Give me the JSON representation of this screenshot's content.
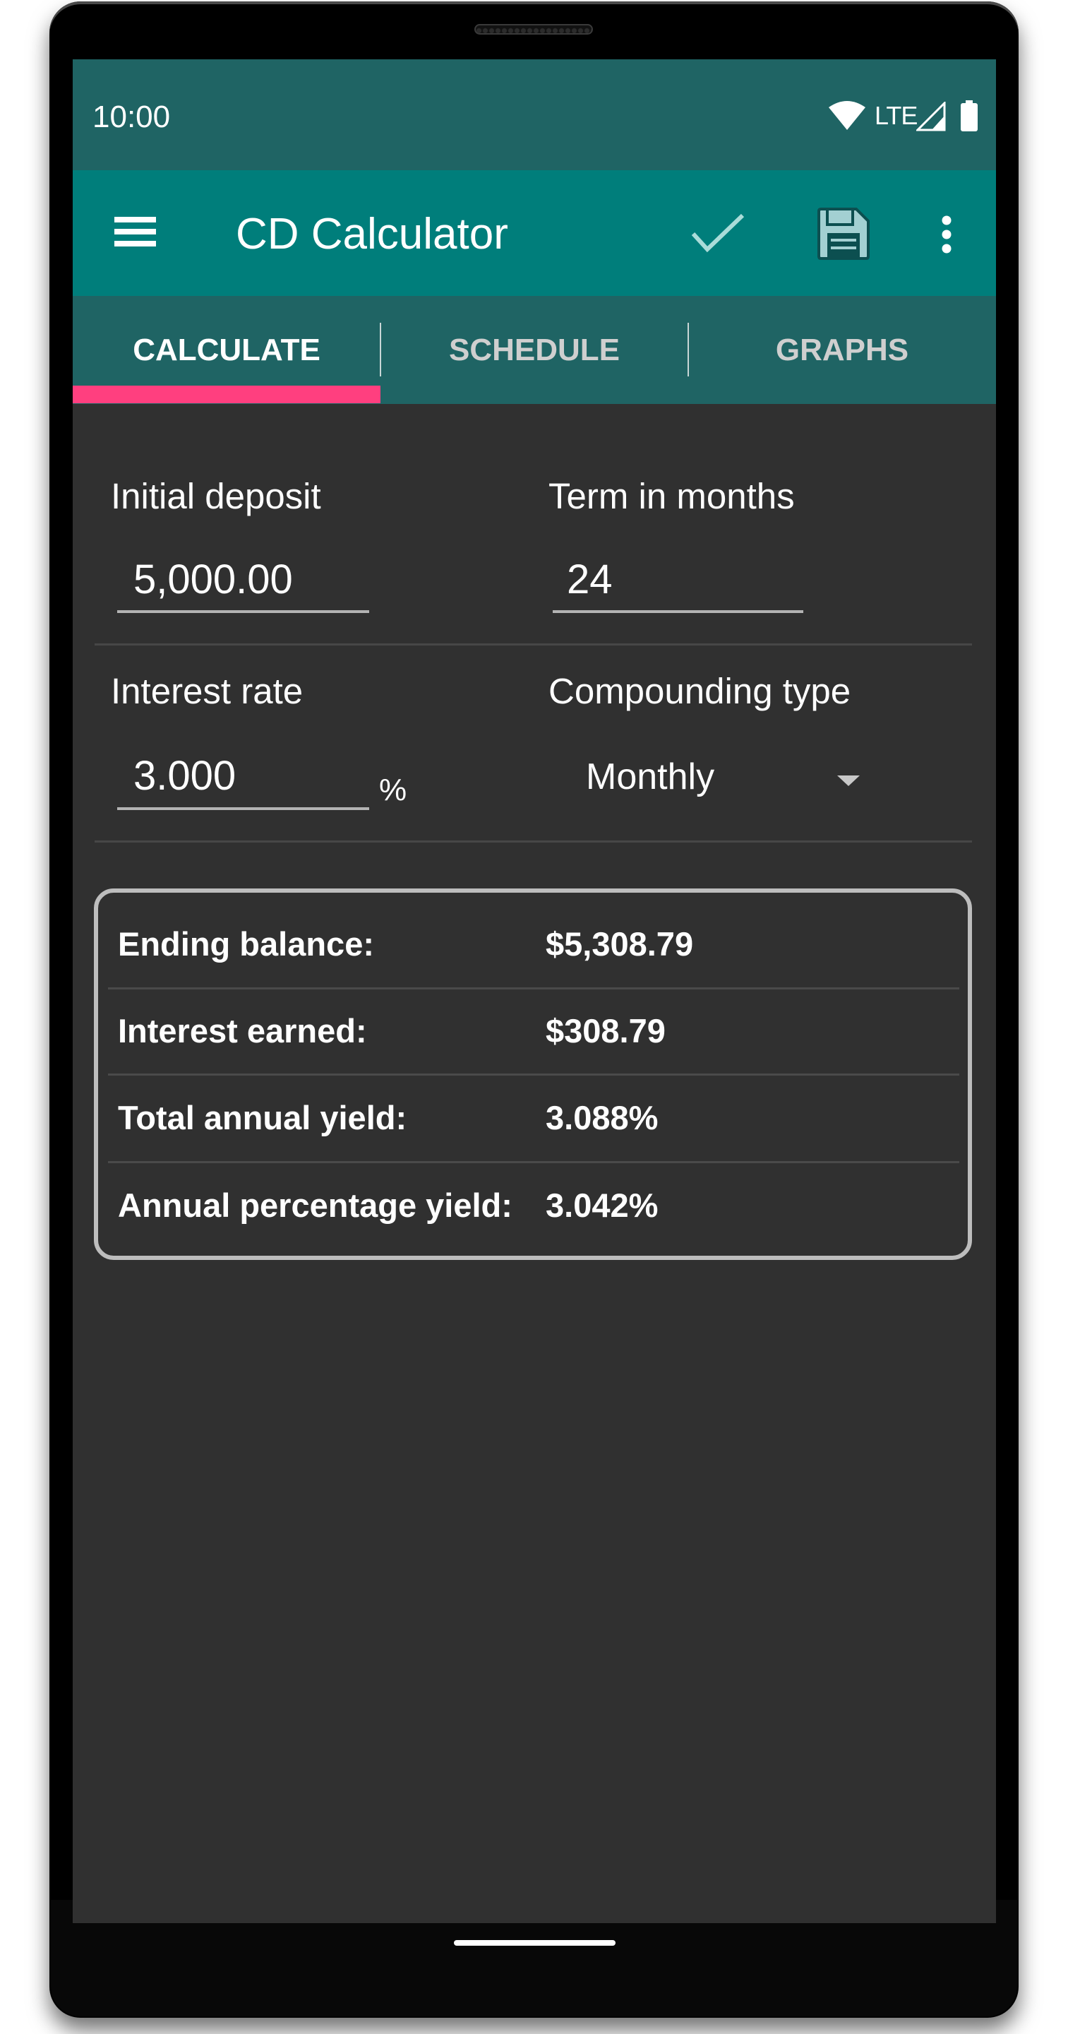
{
  "status_bar": {
    "time": "10:00",
    "network_label": "LTE",
    "icons": [
      "wifi-icon",
      "cell-signal-icon",
      "battery-icon"
    ]
  },
  "toolbar": {
    "menu_icon": "hamburger-menu-icon",
    "title": "CD Calculator",
    "actions": [
      "checkmark-icon",
      "save-floppy-icon",
      "more-vert-icon"
    ]
  },
  "tabs": [
    {
      "label": "CALCULATE",
      "active": true
    },
    {
      "label": "SCHEDULE",
      "active": false
    },
    {
      "label": "GRAPHS",
      "active": false
    }
  ],
  "form": {
    "initial_deposit": {
      "label": "Initial deposit",
      "value": "5,000.00"
    },
    "term_in_months": {
      "label": "Term in months",
      "value": "24"
    },
    "interest_rate": {
      "label": "Interest rate",
      "value": "3.000",
      "unit": "%"
    },
    "compounding_type": {
      "label": "Compounding type",
      "selected": "Monthly"
    }
  },
  "results": [
    {
      "label": "Ending balance:",
      "value": "$5,308.79"
    },
    {
      "label": "Interest earned:",
      "value": "$308.79"
    },
    {
      "label": "Total annual yield:",
      "value": "3.088%"
    },
    {
      "label": "Annual percentage yield:",
      "value": "3.042%"
    }
  ],
  "colors": {
    "status_bar": "#1f6464",
    "toolbar": "#007e7b",
    "tab_indicator": "#ff3f7f",
    "background": "#303030"
  }
}
